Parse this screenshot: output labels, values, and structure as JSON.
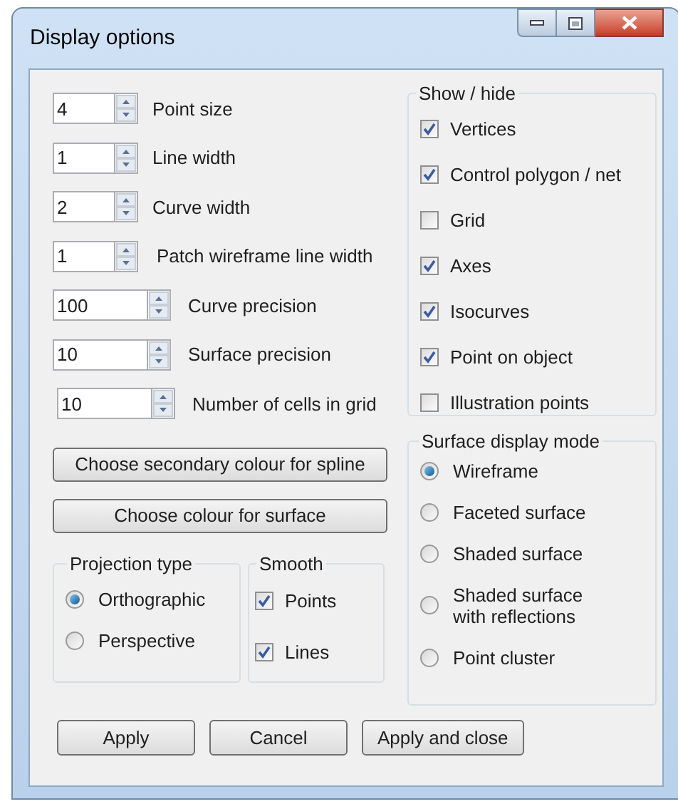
{
  "window": {
    "title": "Display options"
  },
  "spinners": [
    {
      "value": "4",
      "label": "Point size"
    },
    {
      "value": "1",
      "label": "Line width"
    },
    {
      "value": "2",
      "label": "Curve width"
    },
    {
      "value": "1",
      "label": "Patch wireframe line width"
    },
    {
      "value": "100",
      "label": "Curve precision"
    },
    {
      "value": "10",
      "label": "Surface precision"
    },
    {
      "value": "10",
      "label": "Number of cells in grid"
    }
  ],
  "colour_buttons": [
    "Choose secondary colour for spline",
    "Choose colour for surface"
  ],
  "projection": {
    "title": "Projection type",
    "options": [
      {
        "label": "Orthographic",
        "selected": true
      },
      {
        "label": "Perspective",
        "selected": false
      }
    ]
  },
  "smooth": {
    "title": "Smooth",
    "items": [
      {
        "label": "Points",
        "checked": true
      },
      {
        "label": "Lines",
        "checked": true
      }
    ]
  },
  "show_hide": {
    "title": "Show / hide",
    "items": [
      {
        "label": "Vertices",
        "checked": true
      },
      {
        "label": "Control polygon / net",
        "checked": true
      },
      {
        "label": "Grid",
        "checked": false
      },
      {
        "label": "Axes",
        "checked": true
      },
      {
        "label": "Isocurves",
        "checked": true
      },
      {
        "label": "Point on object",
        "checked": true
      },
      {
        "label": "Illustration points",
        "checked": false
      }
    ]
  },
  "surface_mode": {
    "title": "Surface display mode",
    "options": [
      {
        "label": "Wireframe",
        "selected": true
      },
      {
        "label": "Faceted surface",
        "selected": false
      },
      {
        "label": "Shaded surface",
        "selected": false
      },
      {
        "label": "Shaded surface\nwith reflections",
        "selected": false
      },
      {
        "label": "Point cluster",
        "selected": false
      }
    ]
  },
  "buttons": [
    "Apply",
    "Cancel",
    "Apply and close"
  ]
}
